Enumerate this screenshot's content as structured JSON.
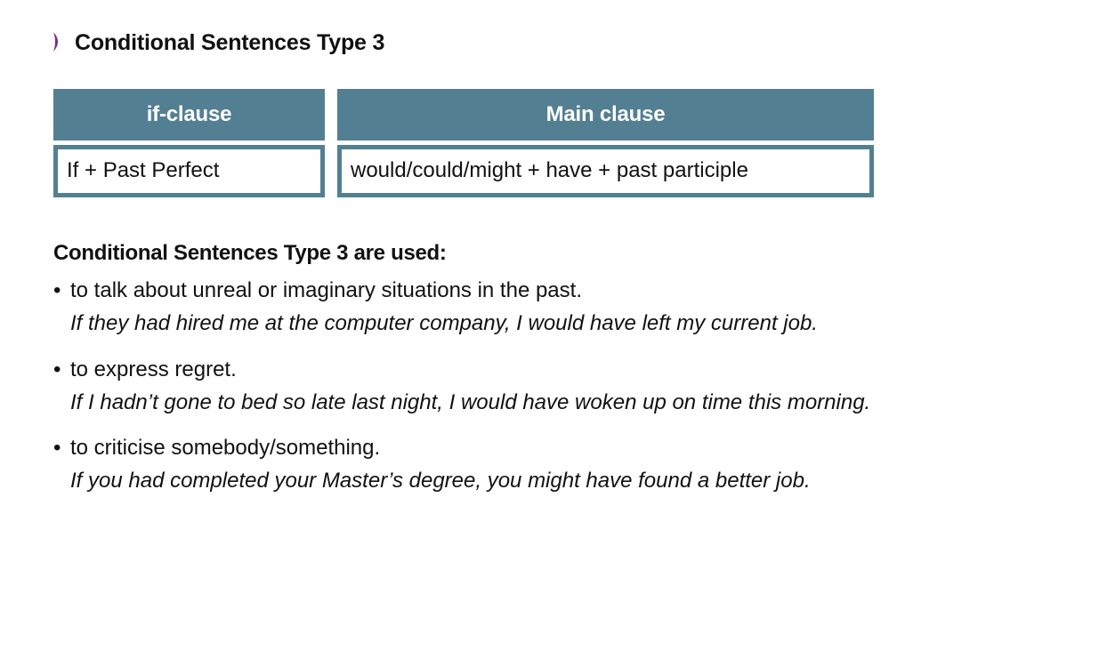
{
  "title": "Conditional Sentences Type 3",
  "accent_color": "#7b2a8c",
  "table_header_color": "#537f92",
  "table": {
    "columns": [
      {
        "header": "if-clause",
        "cell": "If + Past Perfect"
      },
      {
        "header": "Main clause",
        "cell": "would/could/might + have + past participle"
      }
    ]
  },
  "uses": {
    "heading": "Conditional Sentences Type 3 are used:",
    "items": [
      {
        "text": "to talk about unreal or imaginary situations in the past.",
        "example": "If they had hired me at the computer company, I would have left my current job."
      },
      {
        "text": "to express regret.",
        "example": "If I hadn’t gone to bed so late last night, I would have woken up on time this morning."
      },
      {
        "text": "to criticise somebody/something.",
        "example": "If you had completed your Master’s degree, you might have found a better job."
      }
    ]
  }
}
